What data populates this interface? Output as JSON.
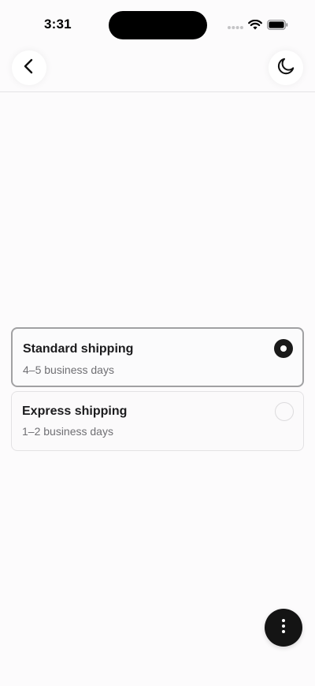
{
  "status_bar": {
    "time": "3:31",
    "icons": [
      "signal-dots-icon",
      "wifi-icon",
      "battery-icon"
    ]
  },
  "nav": {
    "back_icon": "chevron-left-icon",
    "theme_icon": "moon-icon"
  },
  "shipping_options": [
    {
      "title": "Standard shipping",
      "subtitle": "4–5 business days",
      "selected": true
    },
    {
      "title": "Express shipping",
      "subtitle": "1–2 business days",
      "selected": false
    }
  ],
  "fab": {
    "icon": "more-vertical-icon"
  },
  "colors": {
    "background": "#fcfbfc",
    "accent": "#1a1a1a",
    "muted_text": "#6f6f73",
    "border": "#e3e2e4",
    "selected_border": "#a1a1a3"
  }
}
